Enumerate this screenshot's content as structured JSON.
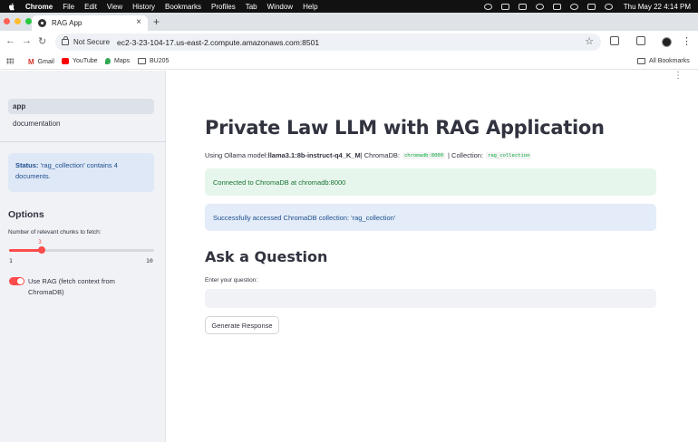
{
  "menubar": {
    "app_name": "Chrome",
    "items": [
      "File",
      "Edit",
      "View",
      "History",
      "Bookmarks",
      "Profiles",
      "Tab",
      "Window",
      "Help"
    ],
    "clock": "Thu May 22  4:14 PM"
  },
  "browser": {
    "tab_title": "RAG App",
    "tab_close": "×",
    "new_tab": "+",
    "not_secure": "Not Secure",
    "url": "ec2-3-23-104-17.us-east-2.compute.amazonaws.com:8501",
    "traffic_colors": [
      "#ff5f57",
      "#febc2e",
      "#28c840"
    ]
  },
  "bookmarks": {
    "items": [
      "Gmail",
      "YouTube",
      "Maps",
      "BU205"
    ],
    "all_bookmarks": "All Bookmarks"
  },
  "sidebar": {
    "nav": [
      "app",
      "documentation"
    ],
    "status_label": "Status:",
    "status_text": " 'rag_collection' contains 4 documents.",
    "options_title": "Options",
    "slider_label": "Number of relevant chunks to fetch:",
    "slider_value": "3",
    "slider_min": "1",
    "slider_max": "10",
    "slider_fraction": 0.222,
    "toggle_label": "Use RAG (fetch context from ChromaDB)",
    "toggle_on": true
  },
  "main": {
    "title": "Private Law LLM with RAG Application",
    "model_prefix": "Using Ollama model: ",
    "model_name": "llama3.1:8b-instruct-q4_K_M",
    "chromadb_label": " | ChromaDB: ",
    "chromadb_host": "chromadb:8000",
    "collection_label": " | Collection: ",
    "collection_name": "rag_collection",
    "success_msg": "Connected to ChromaDB at chromadb:8000",
    "info_msg": "Successfully accessed ChromaDB collection: 'rag_collection'",
    "ask_title": "Ask a Question",
    "question_label": "Enter your question:",
    "question_value": "",
    "generate_button": "Generate Response"
  },
  "colors": {
    "accent": "#ff4b4b",
    "success_bg": "#e7f6ec",
    "info_bg": "#e3ecf8"
  }
}
